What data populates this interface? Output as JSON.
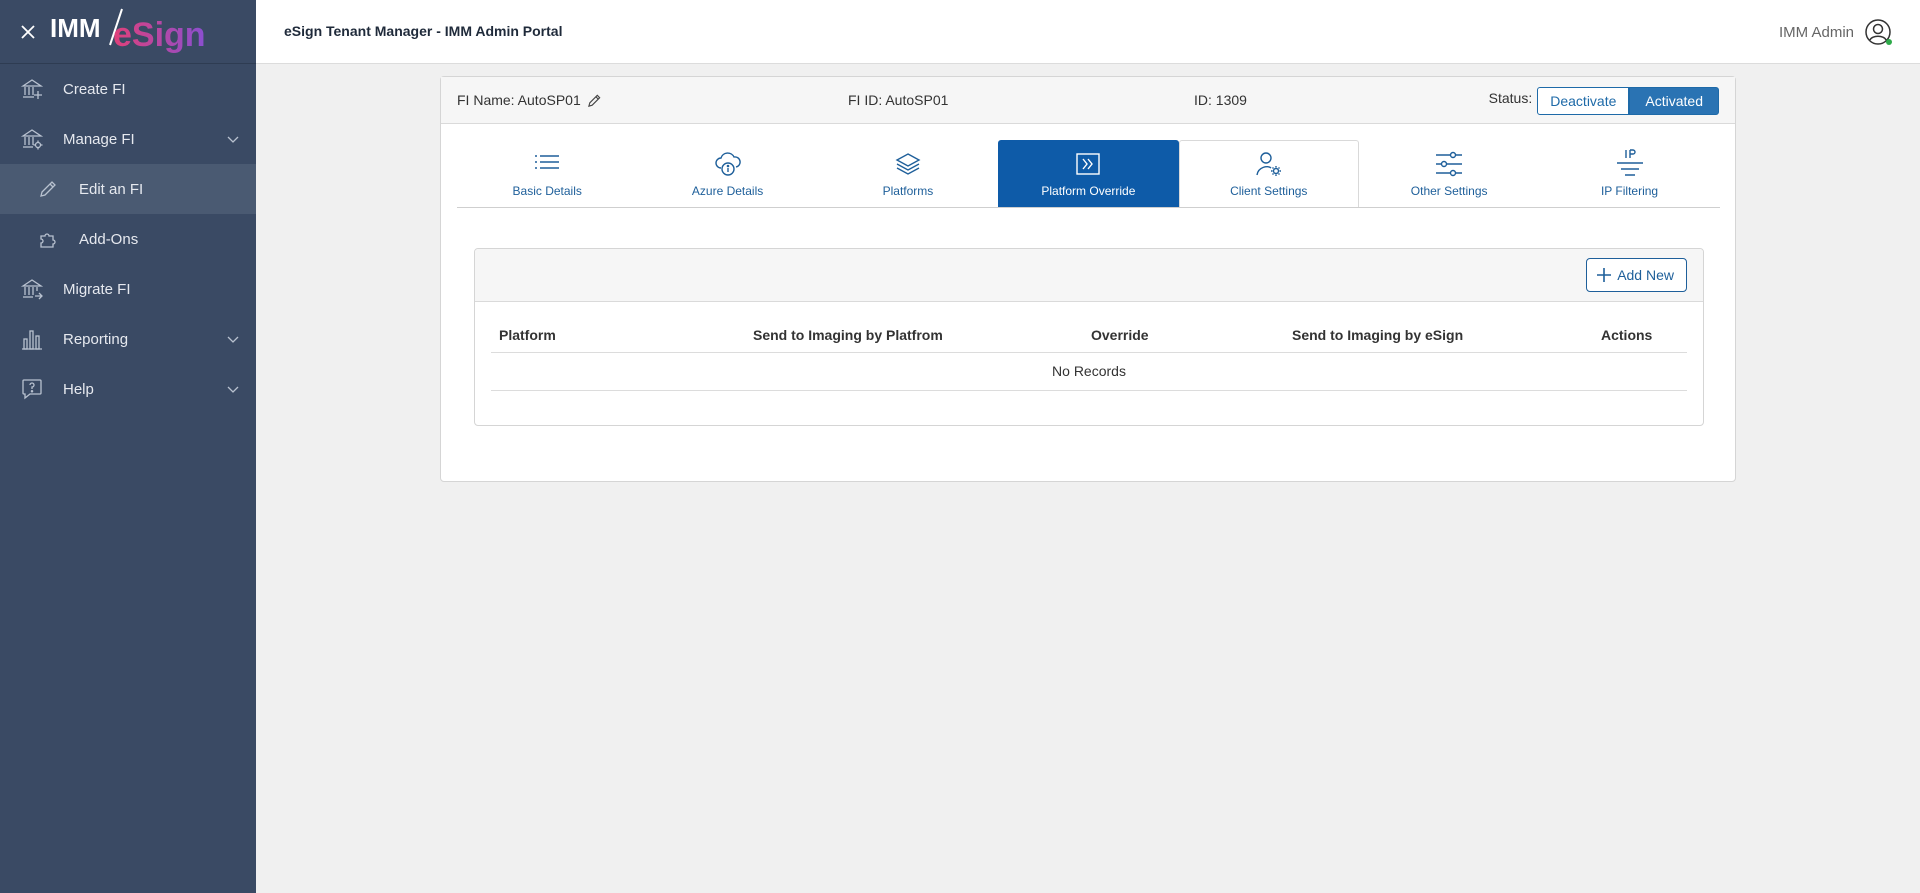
{
  "brand": {
    "logo_text_left": "IMM",
    "logo_text_right": "eSign"
  },
  "sidebar": {
    "items": [
      {
        "label": "Create FI",
        "icon": "bank-plus-icon"
      },
      {
        "label": "Manage FI",
        "icon": "bank-gear-icon",
        "expandable": true
      },
      {
        "label": "Edit an FI",
        "icon": "pencil-icon",
        "sub": true,
        "active": true
      },
      {
        "label": "Add-Ons",
        "icon": "puzzle-icon",
        "sub": true
      },
      {
        "label": "Migrate FI",
        "icon": "bank-arrow-icon"
      },
      {
        "label": "Reporting",
        "icon": "bar-chart-icon",
        "expandable": true
      },
      {
        "label": "Help",
        "icon": "help-chat-icon",
        "expandable": true
      }
    ]
  },
  "topbar": {
    "title": "eSign Tenant Manager - IMM Admin Portal",
    "user_name": "IMM Admin"
  },
  "fi": {
    "name_label": "FI Name: AutoSP01",
    "fi_id_label": "FI ID: AutoSP01",
    "id_label": "ID: 1309",
    "status_label": "Status:",
    "deactivate_label": "Deactivate",
    "activated_label": "Activated"
  },
  "tabs": [
    {
      "label": "Basic Details",
      "icon": "list-icon"
    },
    {
      "label": "Azure Details",
      "icon": "cloud-info-icon"
    },
    {
      "label": "Platforms",
      "icon": "layers-icon"
    },
    {
      "label": "Platform Override",
      "icon": "override-arrow-icon",
      "active": true
    },
    {
      "label": "Client Settings",
      "icon": "user-gear-icon"
    },
    {
      "label": "Other Settings",
      "icon": "sliders-icon"
    },
    {
      "label": "IP Filtering",
      "icon": "ip-filter-icon"
    }
  ],
  "table": {
    "add_new_label": "Add New",
    "columns": [
      "Platform",
      "Send to Imaging by Platfrom",
      "Override",
      "Send to Imaging by eSign",
      "Actions"
    ],
    "empty_text": "No Records"
  },
  "colors": {
    "sidebar": "#3a4a64",
    "primary": "#0e5ba8",
    "accent": "#1e5f9a",
    "logo_pink": "#e0407a",
    "logo_purple": "#8a4fd0"
  }
}
